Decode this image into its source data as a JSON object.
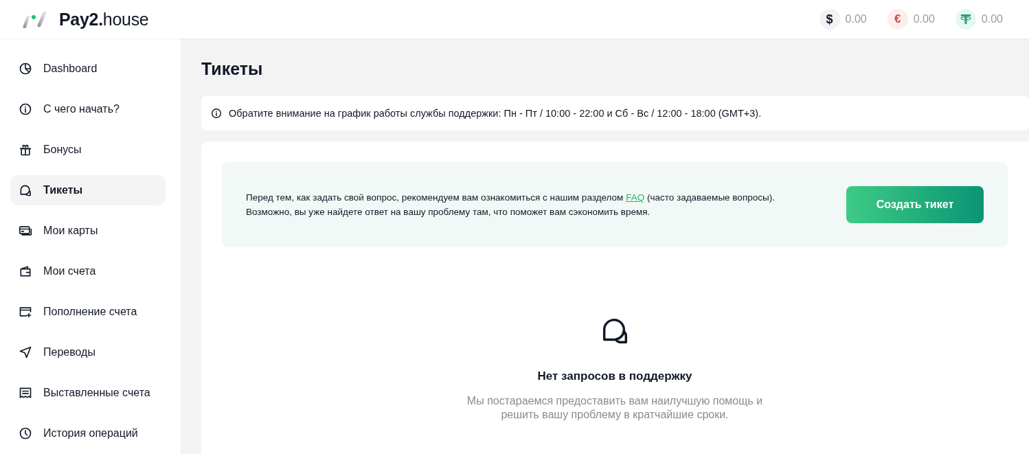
{
  "header": {
    "brand": "**Pay2.**house",
    "balances": [
      {
        "kind": "usd",
        "symbol": "$",
        "amount": "0.00"
      },
      {
        "kind": "eur",
        "symbol": "€",
        "amount": "0.00"
      },
      {
        "kind": "usdt",
        "amount": "0.00"
      }
    ]
  },
  "sidebar": {
    "items": [
      {
        "kind": "pie",
        "label": "Dashboard",
        "selected": false
      },
      {
        "kind": "info",
        "label": "С чего начать?",
        "selected": false
      },
      {
        "kind": "gift",
        "label": "Бонусы",
        "selected": false
      },
      {
        "kind": "chat",
        "label": "Тикеты",
        "selected": true
      },
      {
        "kind": "cards",
        "label": "Мои карты",
        "selected": false
      },
      {
        "kind": "wallet",
        "label": "Мои счета",
        "selected": false
      },
      {
        "kind": "topup",
        "label": "Пополнение счета",
        "selected": false
      },
      {
        "kind": "send",
        "label": "Переводы",
        "selected": false
      },
      {
        "kind": "invoice",
        "label": "Выставленные счета",
        "selected": false
      },
      {
        "kind": "clock",
        "label": "История операций",
        "selected": false
      }
    ]
  },
  "page": {
    "title": "Тикеты",
    "notice": "Обратите внимание на график работы службы поддержки: Пн - Пт / 10:00 - 22:00 и Сб - Вс / 12:00 - 18:00 (GMT+3).",
    "faq_banner": {
      "text_before": "Перед тем, как задать свой вопрос, рекомендуем вам ознакомиться с нашим разделом",
      "link": "FAQ",
      "text_after": "(часто задаваемые вопросы).",
      "text_second_line": "Возможно, вы уже найдете ответ на вашу проблему там, что поможет вам сэкономить время.",
      "button": "Создать тикет"
    },
    "empty_state": {
      "title": "Нет запросов в поддержку",
      "description": "Мы постараемся предоставить вам наилучшую помощь и решить вашу проблему в кратчайшие сроки."
    }
  }
}
